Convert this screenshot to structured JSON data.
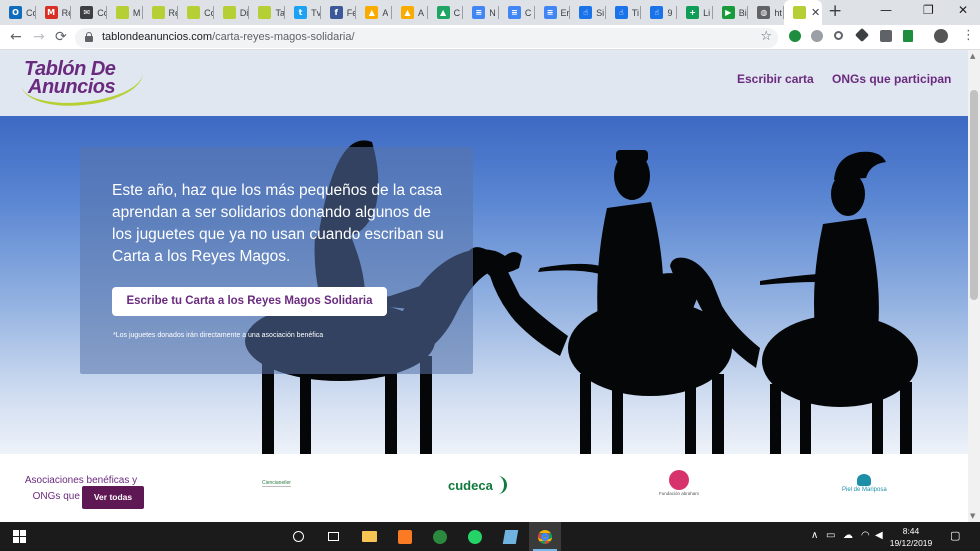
{
  "browser": {
    "tabs": [
      {
        "title": "Co",
        "icon": "outlook-icon",
        "color": "#0f6cbd",
        "glyph": "O"
      },
      {
        "title": "Re",
        "icon": "gmail-icon",
        "color": "#d93025",
        "glyph": "M"
      },
      {
        "title": "Co",
        "icon": "mail-icon",
        "color": "#3c4043",
        "glyph": "✉"
      },
      {
        "title": "M",
        "icon": "tablon-favicon-icon",
        "color": "#b6cf34",
        "glyph": ""
      },
      {
        "title": "Re",
        "icon": "tablon-favicon-icon",
        "color": "#b6cf34",
        "glyph": ""
      },
      {
        "title": "Co",
        "icon": "tablon-favicon-icon",
        "color": "#b6cf34",
        "glyph": ""
      },
      {
        "title": "Di",
        "icon": "tablon-favicon-icon",
        "color": "#b6cf34",
        "glyph": ""
      },
      {
        "title": "Ta",
        "icon": "tablon-favicon-icon",
        "color": "#b6cf34",
        "glyph": ""
      },
      {
        "title": "Tv",
        "icon": "twitter-icon",
        "color": "#1da1f2",
        "glyph": "t"
      },
      {
        "title": "Fe",
        "icon": "facebook-icon",
        "color": "#3b5998",
        "glyph": "f"
      },
      {
        "title": "A",
        "icon": "analytics-icon",
        "color": "#f9ab00",
        "glyph": "▲"
      },
      {
        "title": "A",
        "icon": "analytics-icon",
        "color": "#f9ab00",
        "glyph": "▲"
      },
      {
        "title": "C",
        "icon": "google-drive-icon",
        "color": "#1fa463",
        "glyph": "▲"
      },
      {
        "title": "N",
        "icon": "google-docs-icon",
        "color": "#4285f4",
        "glyph": "≡"
      },
      {
        "title": "C",
        "icon": "google-docs-icon",
        "color": "#4285f4",
        "glyph": "≡"
      },
      {
        "title": "Er",
        "icon": "google-docs-icon",
        "color": "#4285f4",
        "glyph": "≡"
      },
      {
        "title": "Si",
        "icon": "pointer-icon",
        "color": "#1a73e8",
        "glyph": "☝"
      },
      {
        "title": "Ti",
        "icon": "pointer-icon",
        "color": "#1a73e8",
        "glyph": "☝"
      },
      {
        "title": "9",
        "icon": "pointer-icon",
        "color": "#1a73e8",
        "glyph": "☝"
      },
      {
        "title": "Li",
        "icon": "google-sheets-icon",
        "color": "#0f9d58",
        "glyph": "+"
      },
      {
        "title": "Bi",
        "icon": "bitly-icon",
        "color": "#1a9b3b",
        "glyph": "▶"
      },
      {
        "title": "ht",
        "icon": "globe-icon",
        "color": "#5f6368",
        "glyph": "◍"
      }
    ],
    "active_tab_icon_color": "#b6cf34",
    "new_tab": "+",
    "window_controls": {
      "minimize": "—",
      "maximize": "❐",
      "close": "✕"
    },
    "close_tab": "✕",
    "nav": {
      "back": "←",
      "forward": "→",
      "reload": "⟳"
    },
    "url_domain": "tablondeanuncios.com",
    "url_path": "/carta-reyes-magos-solidaria/",
    "bookmark": "☆",
    "menu": "⋮"
  },
  "site": {
    "logo_line1": "Tablón De",
    "logo_line2": "Anuncios",
    "nav": [
      {
        "label": "Escribir carta"
      },
      {
        "label": "ONGs que participan"
      }
    ],
    "accent_color": "#6a2b7f",
    "logo_green": "#b6cf34"
  },
  "hero": {
    "headline": "Este año, haz que los más pequeños de la casa aprendan a ser solidarios donando algunos de los juguetes que ya no usan cuando escriban su Carta a los Reyes Magos.",
    "cta_label": "Escribe tu Carta a los Reyes Magos Solidaria",
    "note": "*Los juguetes donados irán directamente a una asociación benéfica"
  },
  "partners": {
    "label": "Asociaciones benéficas y ONGs que colaboran:",
    "button": "Ver todas",
    "logos": [
      {
        "name": "Ciencianeiler",
        "color": "#2d7a3e"
      },
      {
        "name": "cudeca",
        "color": "#0f7a3c"
      },
      {
        "name": "Fundación abraham",
        "color": "#d6336c"
      },
      {
        "name": "Piel de Mariposa",
        "color": "#1d8fa8"
      }
    ]
  },
  "taskbar": {
    "clock_time": "8:44",
    "clock_date": "19/12/2019"
  }
}
